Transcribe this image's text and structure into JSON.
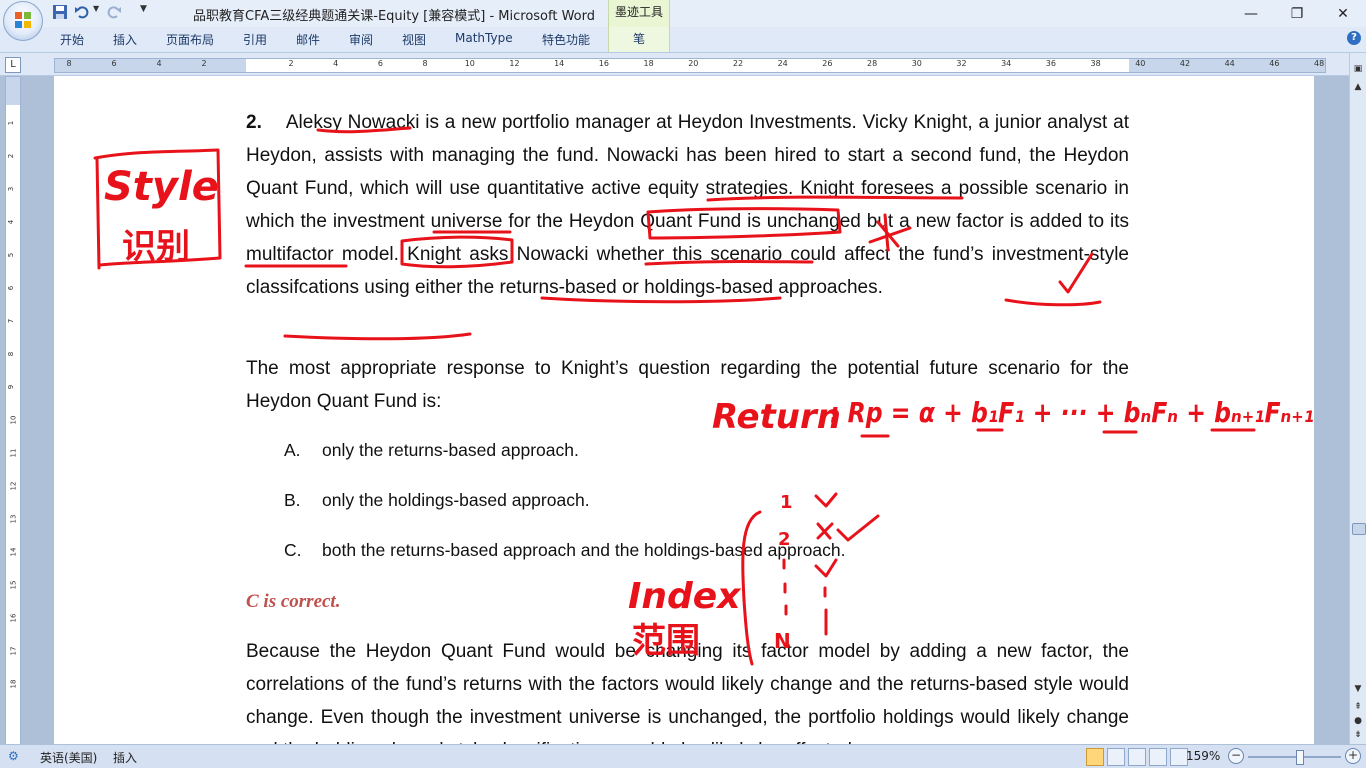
{
  "window": {
    "title": "品职教育CFA三级经典题通关课-Equity [兼容模式] - Microsoft Word",
    "contextual_tab_group": "墨迹工具",
    "controls": {
      "minimize": "—",
      "restore": "❐",
      "close": "✕"
    }
  },
  "quick_access": {
    "save_icon": "save-icon",
    "undo_icon": "undo-icon",
    "redo_icon": "redo-icon",
    "customize": "▼"
  },
  "ribbon": {
    "tabs": [
      "开始",
      "插入",
      "页面布局",
      "引用",
      "邮件",
      "审阅",
      "视图",
      "MathType",
      "特色功能"
    ],
    "contextual_tab": "笔",
    "help": "?"
  },
  "ruler": {
    "tab_selector": "L",
    "h_numbers": [
      "8",
      "6",
      "4",
      "2",
      "2",
      "4",
      "6",
      "8",
      "10",
      "12",
      "14",
      "16",
      "18",
      "20",
      "22",
      "24",
      "26",
      "28",
      "30",
      "32",
      "34",
      "36",
      "38",
      "40",
      "42",
      "44",
      "46",
      "48"
    ],
    "v_numbers": [
      "1",
      "2",
      "3",
      "4",
      "5",
      "6",
      "7",
      "8",
      "9",
      "10",
      "11",
      "12",
      "13",
      "14",
      "15",
      "16",
      "17",
      "18"
    ]
  },
  "document": {
    "question_number": "2.",
    "question_text": "Aleksy Nowacki is a new portfolio manager at Heydon Investments. Vicky Knight, a junior analyst at Heydon, assists with managing the fund. Nowacki has been hired to start a second fund, the Heydon Quant Fund, which will use quantitative active equity strategies. Knight foresees a possible scenario in which the investment universe for the Heydon Quant Fund is unchanged but a new factor is added to its multifactor model. Knight asks Nowacki whether this scenario could affect the fund’s investment-style classifcations using either the returns-based or holdings-based approaches.",
    "prompt": "The most appropriate response to Knight’s question regarding the potential future scenario for the Heydon Quant Fund is:",
    "options": [
      {
        "letter": "A.",
        "text": "only the returns-based  approach."
      },
      {
        "letter": "B.",
        "text": "only the holdings-based  approach."
      },
      {
        "letter": "C.",
        "text": "both the returns-based  approach and the holdings-based  approach."
      }
    ],
    "answer": "C is correct.",
    "explanation": "Because the Heydon Quant Fund would be changing its factor model by adding a new factor, the correlations of the fund’s returns with the factors would likely change and the returns-based style would change. Even though the investment universe is unchanged, the portfolio holdings would likely change and the holdings-based style classifications would also likely be affected."
  },
  "annotations": {
    "style_box": "Style",
    "style_cn": "识别",
    "index_label": "Index",
    "index_cn": "范围",
    "return_formula_label": "Return",
    "return_formula": ": Rp = α + b₁F₁ + ··· + bₙFₙ + bₙ₊₁Fₙ₊₁",
    "list_marks": [
      "1",
      "2",
      "N"
    ]
  },
  "status_bar": {
    "language": "英语(美国)",
    "mode": "插入",
    "zoom": "159%",
    "zoom_out": "−",
    "zoom_in": "+"
  }
}
